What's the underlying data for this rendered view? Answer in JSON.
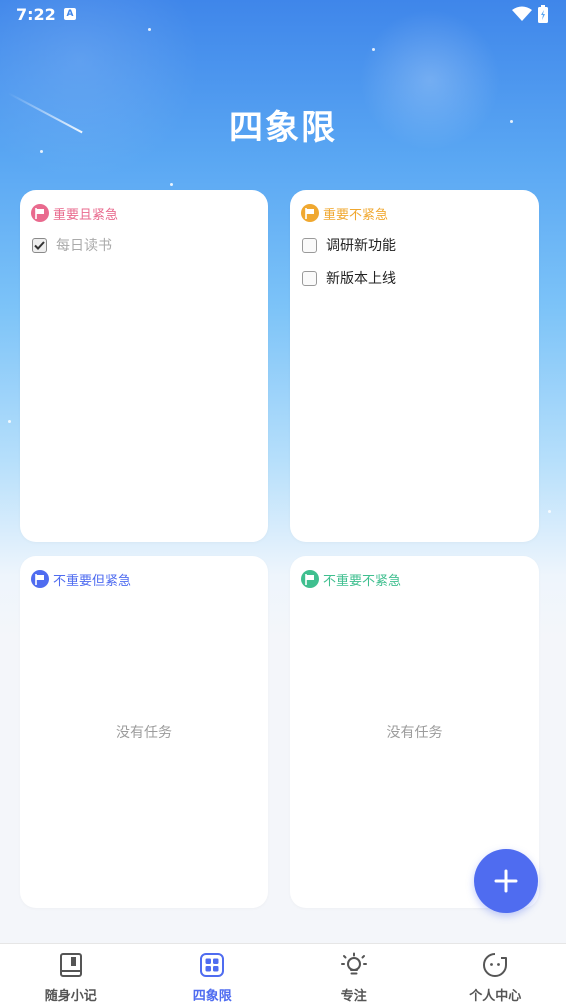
{
  "status": {
    "time": "7:22",
    "notif": "A"
  },
  "title": "四象限",
  "colors": {
    "urgent_important": "#e96a8e",
    "important": "#f0a830",
    "urgent": "#4f6cf0",
    "neither": "#3fbf8f",
    "accent": "#4f6cf0"
  },
  "quadrants": [
    {
      "title": "重要且紧急",
      "tasks": [
        {
          "text": "每日读书",
          "done": true
        }
      ]
    },
    {
      "title": "重要不紧急",
      "tasks": [
        {
          "text": "调研新功能",
          "done": false
        },
        {
          "text": "新版本上线",
          "done": false
        }
      ]
    },
    {
      "title": "不重要但紧急",
      "empty": "没有任务"
    },
    {
      "title": "不重要不紧急",
      "empty": "没有任务"
    }
  ],
  "fab_icon": "plus-icon",
  "tabs": [
    {
      "label": "随身小记",
      "icon": "notebook-icon"
    },
    {
      "label": "四象限",
      "icon": "grid-icon",
      "active": true
    },
    {
      "label": "专注",
      "icon": "lightbulb-icon"
    },
    {
      "label": "个人中心",
      "icon": "face-icon"
    }
  ]
}
